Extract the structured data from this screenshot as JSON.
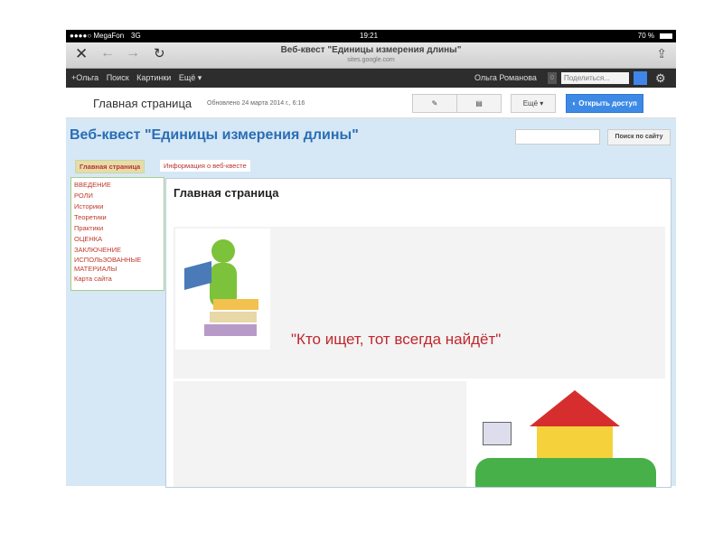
{
  "status": {
    "carrier": "●●●●○ MegaFon",
    "network": "3G",
    "time": "19:21",
    "battery": "70 %"
  },
  "browser": {
    "title": "Веб-квест \"Единицы измерения длины\"",
    "url": "sites.google.com"
  },
  "gbar": {
    "items": [
      "+Ольга",
      "Поиск",
      "Картинки",
      "Ещё ▾"
    ],
    "user": "Ольга Романова",
    "count": "0",
    "share": "Поделиться..."
  },
  "site_header": {
    "page": "Главная страница",
    "updated": "Обновлено 24 марта 2014 г., 6:16",
    "more": "Ещё ▾",
    "share_btn": "Открыть доступ"
  },
  "site": {
    "title": "Веб-квест \"Единицы измерения длины\"",
    "search_btn": "Поиск по сайту",
    "search_value": ""
  },
  "tabs": [
    "Главная страница",
    "Информация о веб-квесте"
  ],
  "sidebar": [
    "ВВЕДЕНИЕ",
    "РОЛИ",
    "Историки",
    "Теоретики",
    "Практики",
    "ОЦЕНКА",
    "ЗАКЛЮЧЕНИЕ",
    "ИСПОЛЬЗОВАННЫЕ МАТЕРИАЛЫ",
    "Карта сайта"
  ],
  "main": {
    "heading": "Главная страница",
    "quote": "\"Кто ищет, тот всегда найдёт\""
  }
}
